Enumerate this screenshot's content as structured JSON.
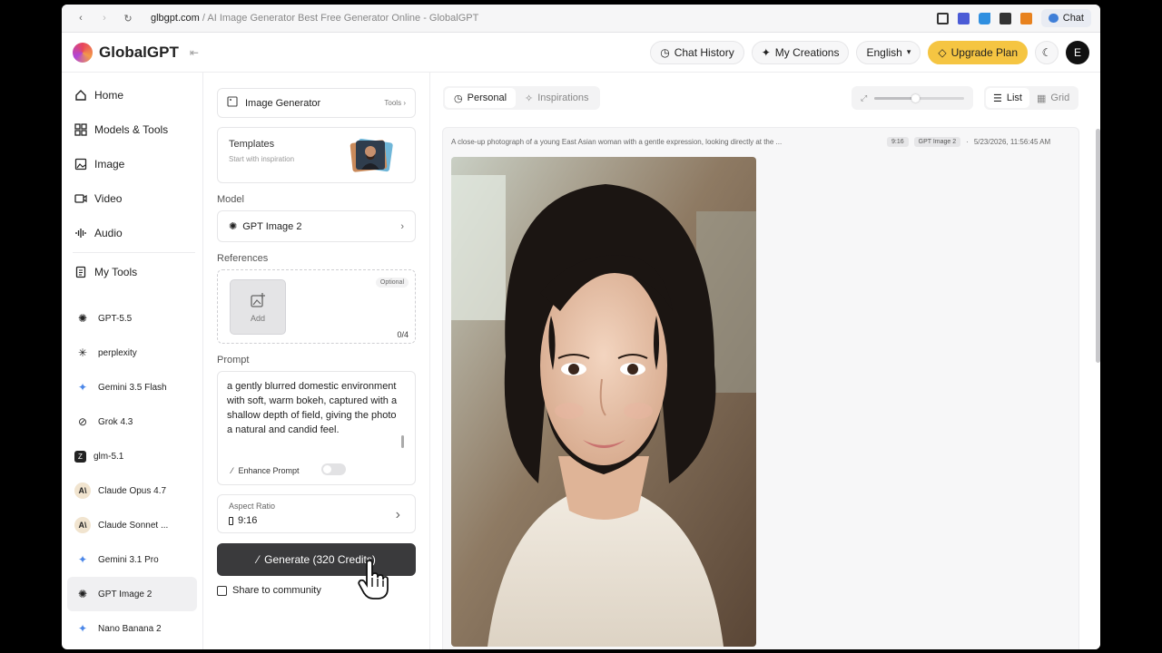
{
  "browser": {
    "url_host": "glbgpt.com",
    "url_rest": " / AI Image Generator Best Free Generator Online - GlobalGPT",
    "chat_label": "Chat"
  },
  "header": {
    "brand": "GlobalGPT",
    "chat_history": "Chat History",
    "my_creations": "My Creations",
    "language": "English",
    "upgrade": "Upgrade Plan",
    "avatar_initial": "E"
  },
  "sidebar": {
    "nav": [
      {
        "label": "Home",
        "icon": "home-icon"
      },
      {
        "label": "Models & Tools",
        "icon": "grid-icon"
      },
      {
        "label": "Image",
        "icon": "image-icon"
      },
      {
        "label": "Video",
        "icon": "video-icon"
      },
      {
        "label": "Audio",
        "icon": "audio-icon"
      }
    ],
    "my_tools": "My Tools",
    "models": [
      {
        "label": "GPT-5.5",
        "icon": "openai-icon"
      },
      {
        "label": "perplexity",
        "icon": "perplexity-icon"
      },
      {
        "label": "Gemini 3.5 Flash",
        "icon": "gemini-icon"
      },
      {
        "label": "Grok 4.3",
        "icon": "grok-icon"
      },
      {
        "label": "glm-5.1",
        "icon": "glm-icon"
      },
      {
        "label": "Claude Opus 4.7",
        "icon": "anthropic-icon"
      },
      {
        "label": "Claude Sonnet ...",
        "icon": "anthropic-icon"
      },
      {
        "label": "Gemini 3.1 Pro",
        "icon": "gemini-icon"
      },
      {
        "label": "GPT Image 2",
        "icon": "openai-icon"
      },
      {
        "label": "Nano Banana 2",
        "icon": "gemini-icon"
      }
    ]
  },
  "panel": {
    "image_generator": "Image Generator",
    "tools": "Tools",
    "templates_title": "Templates",
    "templates_sub": "Start with inspiration",
    "model_label": "Model",
    "model_value": "GPT Image 2",
    "references_label": "References",
    "add_label": "Add",
    "optional": "Optional",
    "ref_count": "0/4",
    "prompt_label": "Prompt",
    "prompt_text": "a gently blurred domestic environment with soft, warm bokeh, captured with a shallow depth of field, giving the photo a natural and candid feel.",
    "enhance_prompt": "Enhance Prompt",
    "aspect_label": "Aspect Ratio",
    "aspect_value": "9:16",
    "generate": "Generate (320 Credits)",
    "share": "Share to community"
  },
  "results": {
    "tab_personal": "Personal",
    "tab_inspirations": "Inspirations",
    "view_list": "List",
    "view_grid": "Grid",
    "zoom_fraction": 0.45,
    "prompt_preview": "A close-up photograph of a young East Asian woman with a gentle expression, looking directly at the ...",
    "ratio_chip": "9:16",
    "model_chip": "GPT Image 2",
    "timestamp": "5/23/2026, 11:56:45 AM"
  },
  "colors": {
    "upgrade": "#f5c542",
    "generate": "#3a3a3c",
    "active_model_bg": "#f0f0f2"
  }
}
